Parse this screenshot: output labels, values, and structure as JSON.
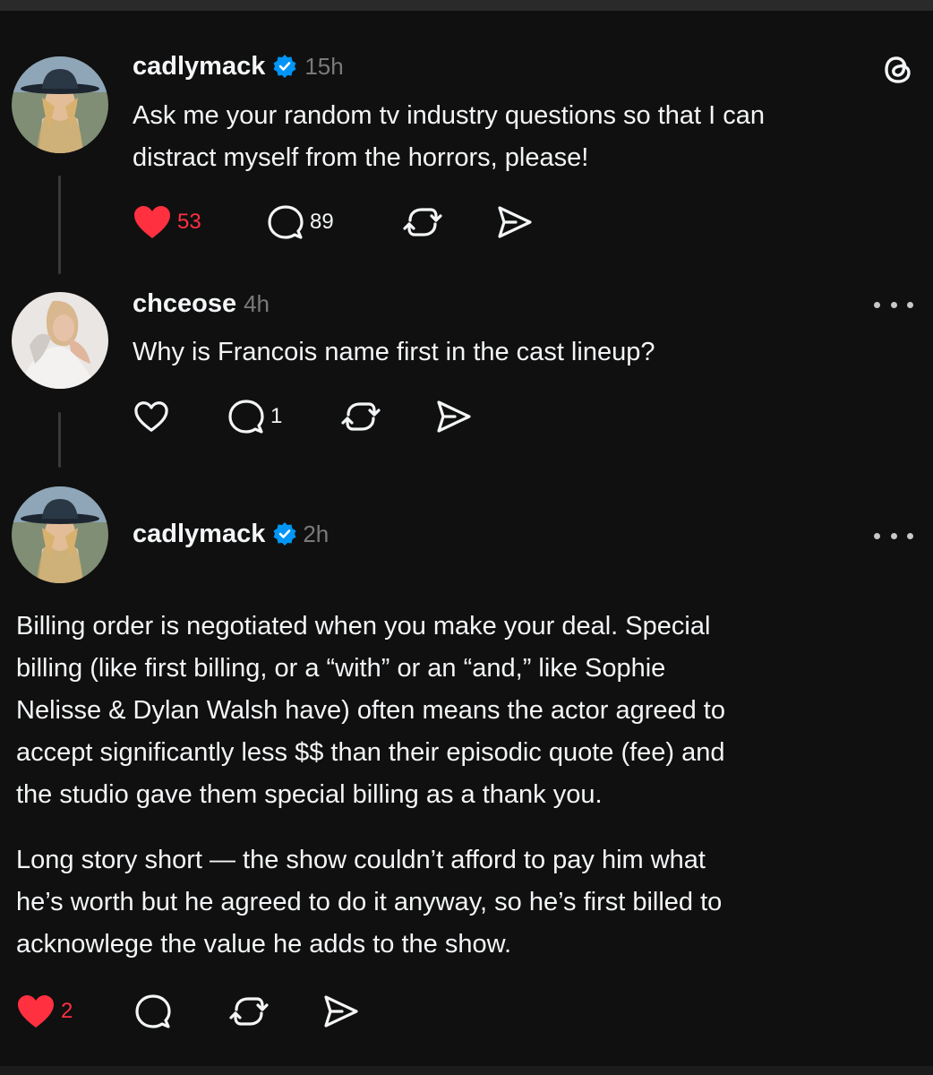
{
  "post1": {
    "username": "cadlymack",
    "time": "15h",
    "lines": [
      "Ask me your random tv industry questions so that I can",
      "distract myself from the horrors, please!"
    ],
    "likes": "53",
    "replies": "89"
  },
  "reply": {
    "username": "chceose",
    "time": "4h",
    "lines": [
      "Why is Francois name first in the cast lineup?"
    ],
    "replies": "1"
  },
  "post2": {
    "username": "cadlymack",
    "time": "2h",
    "paragraph1": [
      "Billing order is negotiated when you make your deal. Special",
      "billing (like first billing, or a “with” or an “and,” like Sophie",
      "Nelisse & Dylan Walsh have) often means the actor agreed to",
      "accept significantly less $$ than their episodic quote (fee) and",
      "the studio gave them special billing as a thank you."
    ],
    "paragraph2": [
      "Long story short — the show couldn’t afford to pay him what",
      "he’s worth but he agreed to do it anyway, so he’s first billed to",
      "acknowlege the value he adds to the show."
    ],
    "likes": "2"
  },
  "icons": {
    "threads": "threads-logo-icon",
    "verified": "verified-badge-icon",
    "like": "heart-icon",
    "reply": "speech-bubble-icon",
    "repost": "repost-icon",
    "share": "send-icon",
    "more": "more-dots-icon"
  },
  "colors": {
    "background": "#101010",
    "text": "#f3f5f7",
    "muted": "#7a7a7a",
    "like": "#ff3040",
    "verified": "#0095f6"
  }
}
